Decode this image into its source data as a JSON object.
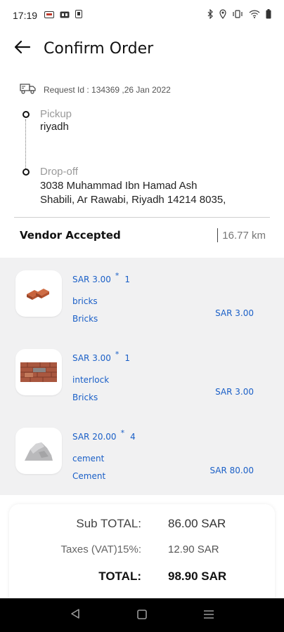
{
  "status_bar": {
    "time": "17:19",
    "left_icons": [
      "app-notification-icon",
      "media-icon",
      "device-icon"
    ],
    "right_icons": [
      "bluetooth-icon",
      "location-icon",
      "vibrate-icon",
      "wifi-icon",
      "battery-icon"
    ]
  },
  "header": {
    "title": "Confirm Order",
    "back_icon": "arrow-left-icon"
  },
  "request": {
    "icon": "delivery-truck-icon",
    "text": "Request Id : 134369 ,26 Jan 2022"
  },
  "route": {
    "pickup_label": "Pickup",
    "pickup_value": "riyadh",
    "dropoff_label": "Drop-off",
    "dropoff_line1": "3038 Muhammad Ibn Hamad Ash",
    "dropoff_line2": "Shabili, Ar Rawabi, Riyadh 14214 8035,"
  },
  "vendor": {
    "status": "Vendor Accepted",
    "distance": "16.77 km"
  },
  "items": [
    {
      "price": "SAR  3.00",
      "star": "*",
      "qty": "1",
      "name": "bricks",
      "category": "Bricks",
      "total": "SAR  3.00",
      "image": "bricks-image"
    },
    {
      "price": "SAR  3.00",
      "star": "*",
      "qty": "1",
      "name": "interlock",
      "category": "Bricks",
      "total": "SAR  3.00",
      "image": "interlock-image"
    },
    {
      "price": "SAR  20.00",
      "star": "*",
      "qty": "4",
      "name": "cement",
      "category": "Cement",
      "total": "SAR  80.00",
      "image": "cement-image"
    }
  ],
  "summary": {
    "subtotal_label": "Sub TOTAL:",
    "subtotal_value": "86.00 SAR",
    "tax_label": "Taxes (VAT)15%:",
    "tax_value": "12.90 SAR",
    "total_label": "TOTAL:",
    "total_value": "98.90 SAR"
  },
  "nav": {
    "back": "nav-back-icon",
    "home": "nav-home-icon",
    "menu": "nav-menu-icon"
  },
  "colors": {
    "accent": "#1a5fc7",
    "items_bg": "#f1f1f2",
    "muted": "#9a9a9a"
  }
}
